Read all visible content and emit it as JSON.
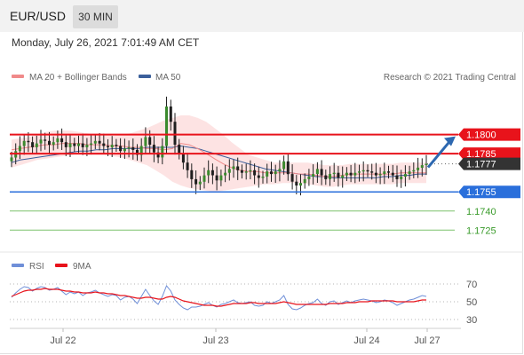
{
  "header": {
    "symbol": "EUR/USD",
    "timeframe": "30 MIN"
  },
  "datetime": "Monday, July 26, 2021 7:01:49 AM CET",
  "credit": "Research © 2021 Trading Central",
  "colors": {
    "resistance": "#e8131b",
    "support": "#2a6fdb",
    "target": "#3a9b2b",
    "current": "#333333",
    "ma20": "#f08a8a",
    "ma50": "#3b5f9b",
    "band": "#fde0e0",
    "rsi": "#6f8fd8",
    "rsi_ma": "#e8131b",
    "arrow": "#2d68b0"
  },
  "chart_data": [
    {
      "type": "candlestick",
      "legend": [
        {
          "name": "MA 20 + Bollinger Bands",
          "color": "#f08a8a"
        },
        {
          "name": "MA 50",
          "color": "#3b5f9b"
        }
      ],
      "x_ticks": [
        "Jul 22",
        "Jul 23",
        "Jul 24",
        "Jul 27"
      ],
      "ylim": [
        1.1712,
        1.1838
      ],
      "levels": [
        {
          "value": 1.18,
          "label": "1.1800",
          "kind": "resistance"
        },
        {
          "value": 1.1785,
          "label": "1.1785",
          "kind": "resistance"
        },
        {
          "value": 1.1777,
          "label": "1.1777",
          "kind": "current"
        },
        {
          "value": 1.1755,
          "label": "1.1755",
          "kind": "support"
        },
        {
          "value": 1.174,
          "label": "1.1740",
          "kind": "target"
        },
        {
          "value": 1.1725,
          "label": "1.1725",
          "kind": "target"
        }
      ],
      "close": [
        1.1782,
        1.1787,
        1.1791,
        1.1795,
        1.1794,
        1.179,
        1.1793,
        1.1796,
        1.1795,
        1.1792,
        1.1794,
        1.1797,
        1.1794,
        1.179,
        1.1793,
        1.1791,
        1.1793,
        1.179,
        1.1792,
        1.1793,
        1.1795,
        1.1793,
        1.1791,
        1.179,
        1.1792,
        1.1791,
        1.1787,
        1.1789,
        1.179,
        1.1788,
        1.1784,
        1.1791,
        1.1798,
        1.1792,
        1.1786,
        1.1782,
        1.1791,
        1.1822,
        1.181,
        1.1792,
        1.1785,
        1.1778,
        1.1772,
        1.1765,
        1.1761,
        1.1763,
        1.1768,
        1.1772,
        1.1768,
        1.1764,
        1.1768,
        1.177,
        1.1773,
        1.1775,
        1.1772,
        1.177,
        1.1771,
        1.1772,
        1.1768,
        1.1766,
        1.1767,
        1.1771,
        1.1769,
        1.1771,
        1.1773,
        1.1779,
        1.1769,
        1.1763,
        1.176,
        1.1762,
        1.1765,
        1.1767,
        1.1769,
        1.1773,
        1.1768,
        1.1765,
        1.1769,
        1.177,
        1.1766,
        1.1768,
        1.177,
        1.1768,
        1.177,
        1.1771,
        1.1772,
        1.1771,
        1.177,
        1.1768,
        1.1769,
        1.1771,
        1.177,
        1.1768,
        1.1765,
        1.1767,
        1.1769,
        1.1771,
        1.1772,
        1.1774,
        1.1776,
        1.1777
      ],
      "ma20": [
        1.1788,
        1.1789,
        1.179,
        1.1791,
        1.1792,
        1.1792,
        1.1793,
        1.1793,
        1.1793,
        1.1792,
        1.1792,
        1.1792,
        1.1791,
        1.1791,
        1.179,
        1.179,
        1.1789,
        1.1789,
        1.1788,
        1.1789,
        1.1793,
        1.1792,
        1.1789,
        1.1785,
        1.1781,
        1.1777,
        1.1774,
        1.1772,
        1.1771,
        1.1771,
        1.177,
        1.177,
        1.177,
        1.177,
        1.1769,
        1.1769,
        1.1768,
        1.1767,
        1.1767,
        1.1768,
        1.1769,
        1.1769,
        1.1769,
        1.1769,
        1.1769,
        1.1769,
        1.177,
        1.177,
        1.177,
        1.177
      ],
      "ma50": [
        1.1778,
        1.178,
        1.1781,
        1.1782,
        1.1783,
        1.1784,
        1.1785,
        1.1786,
        1.1787,
        1.1787,
        1.1788,
        1.1788,
        1.1789,
        1.1789,
        1.1789,
        1.1789,
        1.179,
        1.179,
        1.179,
        1.179,
        1.1791,
        1.179,
        1.1789,
        1.1787,
        1.1785,
        1.1783,
        1.1781,
        1.1779,
        1.1777,
        1.1775,
        1.1773,
        1.1772,
        1.1771,
        1.177,
        1.1769,
        1.1768,
        1.1767,
        1.1767,
        1.1766,
        1.1766,
        1.1766,
        1.1766,
        1.1766,
        1.1766,
        1.1767,
        1.1767,
        1.1768,
        1.1768,
        1.1769,
        1.1769
      ],
      "bb_upper": [
        1.1796,
        1.1797,
        1.1798,
        1.18,
        1.1802,
        1.1803,
        1.1803,
        1.1803,
        1.1802,
        1.1801,
        1.18,
        1.18,
        1.1799,
        1.18,
        1.1801,
        1.1803,
        1.1805,
        1.1808,
        1.1811,
        1.1813,
        1.1815,
        1.1815,
        1.1813,
        1.181,
        1.1805,
        1.18,
        1.1794,
        1.1789,
        1.1784,
        1.1782,
        1.178,
        1.1778,
        1.1778,
        1.1778,
        1.1778,
        1.1778,
        1.1777,
        1.1776,
        1.1776,
        1.1776,
        1.1777,
        1.1777,
        1.1777,
        1.1777,
        1.1777,
        1.1777,
        1.1778,
        1.1778,
        1.1778,
        1.1778
      ],
      "bb_lower": [
        1.1774,
        1.1776,
        1.1778,
        1.178,
        1.1781,
        1.1782,
        1.1783,
        1.1784,
        1.1785,
        1.1784,
        1.1784,
        1.1784,
        1.1783,
        1.1782,
        1.178,
        1.1778,
        1.1776,
        1.1772,
        1.1768,
        1.1763,
        1.176,
        1.1758,
        1.1757,
        1.1756,
        1.1755,
        1.1756,
        1.1757,
        1.1758,
        1.1759,
        1.176,
        1.1761,
        1.1761,
        1.1762,
        1.1762,
        1.1762,
        1.1761,
        1.176,
        1.1759,
        1.1759,
        1.176,
        1.1761,
        1.1761,
        1.1761,
        1.1761,
        1.1761,
        1.1761,
        1.1762,
        1.1762,
        1.1762,
        1.1762
      ]
    },
    {
      "type": "line",
      "legend": [
        {
          "name": "RSI",
          "color": "#6f8fd8"
        },
        {
          "name": "9MA",
          "color": "#e8131b"
        }
      ],
      "ylim": [
        22,
        78
      ],
      "y_ticks": [
        70,
        50,
        30
      ],
      "rsi": [
        55,
        60,
        64,
        67,
        66,
        62,
        65,
        67,
        66,
        63,
        64,
        66,
        62,
        58,
        61,
        59,
        61,
        57,
        60,
        61,
        63,
        60,
        58,
        56,
        58,
        57,
        52,
        55,
        56,
        53,
        48,
        56,
        64,
        57,
        51,
        47,
        56,
        68,
        62,
        52,
        47,
        43,
        41,
        44,
        44,
        45,
        47,
        49,
        46,
        44,
        47,
        48,
        50,
        52,
        49,
        48,
        49,
        50,
        46,
        45,
        46,
        50,
        48,
        50,
        52,
        57,
        47,
        42,
        41,
        43,
        46,
        48,
        49,
        53,
        48,
        46,
        50,
        51,
        47,
        49,
        51,
        49,
        51,
        52,
        53,
        52,
        51,
        49,
        50,
        52,
        51,
        49,
        46,
        48,
        50,
        52,
        53,
        55,
        57,
        56
      ],
      "ma9": [
        56,
        58,
        60,
        62,
        63,
        63,
        64,
        64,
        65,
        64,
        64,
        64,
        63,
        62,
        62,
        61,
        61,
        60,
        60,
        60,
        61,
        60,
        60,
        59,
        59,
        58,
        57,
        57,
        56,
        55,
        54,
        54,
        55,
        55,
        54,
        53,
        53,
        55,
        56,
        55,
        53,
        51,
        50,
        49,
        48,
        47,
        46,
        46,
        46,
        45,
        45,
        46,
        47,
        48,
        48,
        48,
        48,
        49,
        49,
        48,
        48,
        48,
        48,
        48,
        49,
        50,
        49,
        48,
        47,
        47,
        47,
        47,
        47,
        47,
        47,
        47,
        48,
        48,
        48,
        48,
        49,
        49,
        49,
        50,
        50,
        50,
        51,
        51,
        51,
        51,
        51,
        51,
        50,
        50,
        50,
        50,
        50,
        51,
        52,
        52
      ]
    }
  ]
}
